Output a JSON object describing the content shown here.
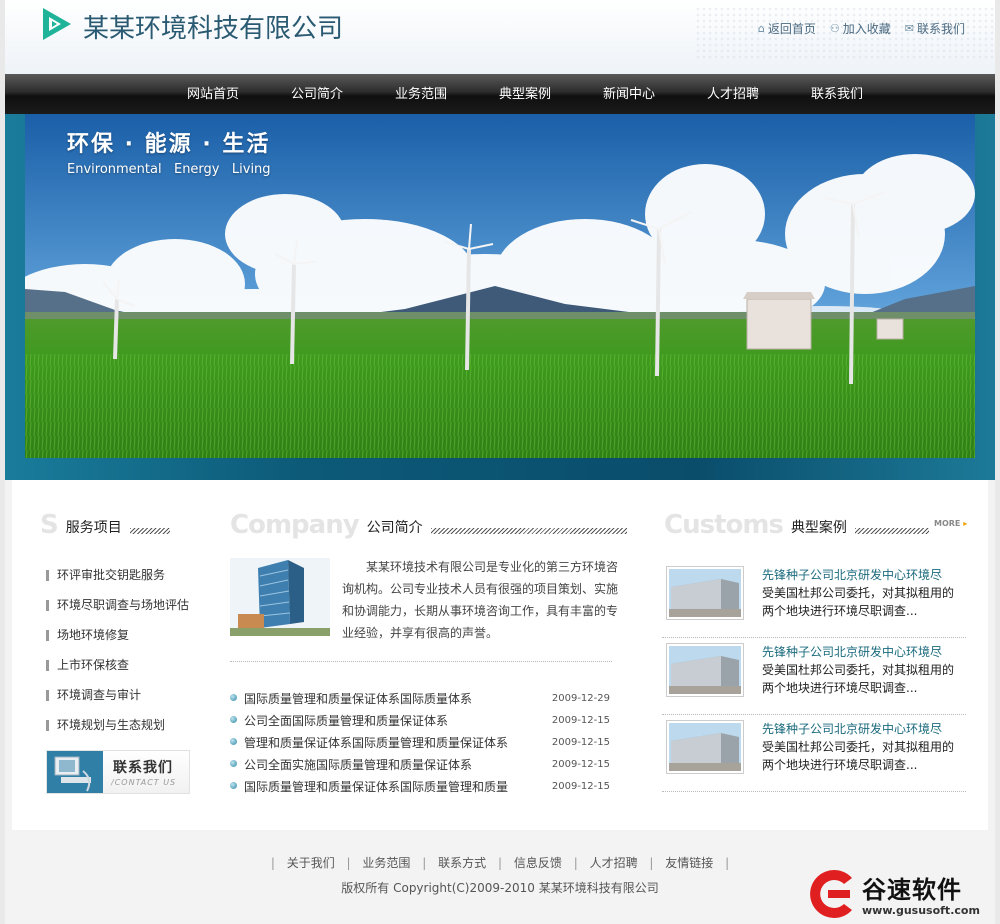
{
  "header": {
    "company_name": "某某环境科技有限公司",
    "links": [
      {
        "label": "返回首页",
        "icon": "home-icon"
      },
      {
        "label": "加入收藏",
        "icon": "bookmark-icon"
      },
      {
        "label": "联系我们",
        "icon": "mail-icon"
      }
    ]
  },
  "nav": {
    "items": [
      "网站首页",
      "公司简介",
      "业务范围",
      "典型案例",
      "新闻中心",
      "人才招聘",
      "联系我们"
    ]
  },
  "banner": {
    "slogan_cn": "环保 · 能源 · 生活",
    "slogan_en": "Environmental   Energy   Living"
  },
  "services": {
    "big_letter": "S",
    "title": "服务项目",
    "items": [
      "环评审批交钥匙服务",
      "环境尽职调查与场地评估",
      "场地环境修复",
      "上市环保核查",
      "环境调查与审计",
      "环境规划与生态规划"
    ],
    "contact_cn": "联系我们",
    "contact_en": "/CONTACT US"
  },
  "company": {
    "big_word": "Company",
    "title": "公司简介",
    "intro": "某某环境技术有限公司是专业化的第三方环境咨询机构。公司专业技术人员有很强的项目策划、实施和协调能力，长期从事环境咨询工作，具有丰富的专业经验，并享有很高的声誉。",
    "news": [
      {
        "title": "国际质量管理和质量保证体系国际质量体系",
        "date": "2009-12-29"
      },
      {
        "title": "公司全面国际质量管理和质量保证体系",
        "date": "2009-12-15"
      },
      {
        "title": "管理和质量保证体系国际质量管理和质量保证体系",
        "date": "2009-12-15"
      },
      {
        "title": "公司全面实施国际质量管理和质量保证体系",
        "date": "2009-12-15"
      },
      {
        "title": "国际质量管理和质量保证体系国际质量管理和质量",
        "date": "2009-12-15"
      }
    ]
  },
  "cases": {
    "big_word": "Customs",
    "title": "典型案例",
    "more": "MORE",
    "items": [
      {
        "title": "先锋种子公司北京研发中心环境尽",
        "desc": "受美国杜邦公司委托，对其拟租用的两个地块进行环境尽职调查..."
      },
      {
        "title": "先锋种子公司北京研发中心环境尽",
        "desc": "受美国杜邦公司委托，对其拟租用的两个地块进行环境尽职调查..."
      },
      {
        "title": "先锋种子公司北京研发中心环境尽",
        "desc": "受美国杜邦公司委托，对其拟租用的两个地块进行环境尽职调查..."
      }
    ]
  },
  "footer": {
    "links": [
      "关于我们",
      "业务范围",
      "联系方式",
      "信息反馈",
      "人才招聘",
      "友情链接"
    ],
    "separator": "|",
    "copyright": "版权所有 Copyright(C)2009-2010 某某环境科技有限公司"
  },
  "watermark": {
    "name": "谷速软件",
    "url": "www.gususoft.com"
  },
  "colors": {
    "accent": "#1fb39a",
    "title_blue": "#2a5a72",
    "banner_frame": "#0c5a78",
    "link_teal": "#1a6a7d"
  }
}
